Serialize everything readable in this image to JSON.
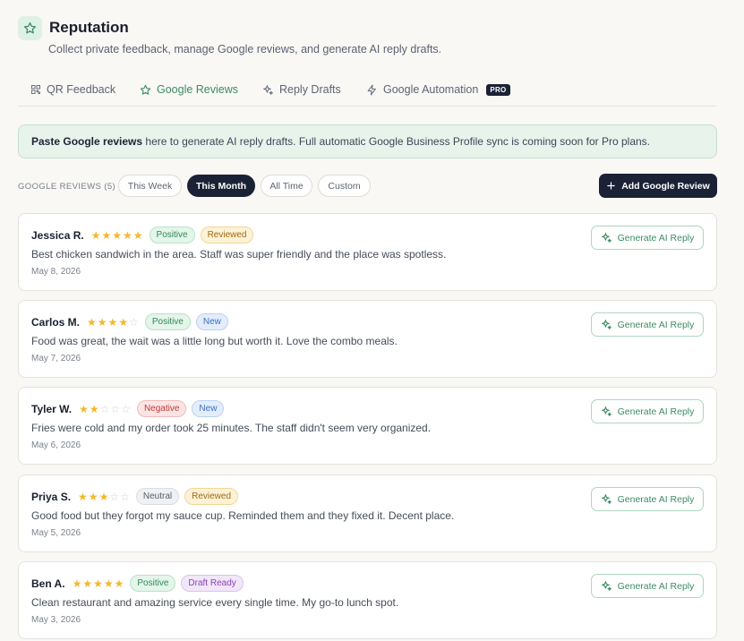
{
  "header": {
    "title": "Reputation",
    "subtitle": "Collect private feedback, manage Google reviews, and generate AI reply drafts."
  },
  "tabs": [
    {
      "label": "QR Feedback",
      "icon": "qr-grid-icon"
    },
    {
      "label": "Google Reviews",
      "icon": "star-icon",
      "active": true
    },
    {
      "label": "Reply Drafts",
      "icon": "sparkle-icon"
    },
    {
      "label": "Google Automation",
      "icon": "bolt-icon",
      "badge": "PRO"
    }
  ],
  "banner": {
    "bold": "Paste Google reviews",
    "text": " here to generate AI reply drafts. Full automatic Google Business Profile sync is coming soon for Pro plans."
  },
  "filters": {
    "count_label": "GOOGLE REVIEWS (5)",
    "pills": [
      "This Week",
      "This Month",
      "All Time",
      "Custom"
    ],
    "active": "This Month",
    "add_button": "Add Google Review"
  },
  "colors": {
    "accent_green": "#3c8c62",
    "dark_navy": "#1c2236",
    "star_gold": "#f4b82b"
  },
  "generate_label": "Generate AI Reply",
  "reviews": [
    {
      "name": "Jessica R.",
      "rating": 5,
      "sentiment": "Positive",
      "status": "Reviewed",
      "text": "Best chicken sandwich in the area. Staff was super friendly and the place was spotless.",
      "date": "May 8, 2026"
    },
    {
      "name": "Carlos M.",
      "rating": 4,
      "sentiment": "Positive",
      "status": "New",
      "text": "Food was great, the wait was a little long but worth it. Love the combo meals.",
      "date": "May 7, 2026"
    },
    {
      "name": "Tyler W.",
      "rating": 2,
      "sentiment": "Negative",
      "status": "New",
      "text": "Fries were cold and my order took 25 minutes. The staff didn't seem very organized.",
      "date": "May 6, 2026"
    },
    {
      "name": "Priya S.",
      "rating": 3,
      "sentiment": "Neutral",
      "status": "Reviewed",
      "text": "Good food but they forgot my sauce cup. Reminded them and they fixed it. Decent place.",
      "date": "May 5, 2026"
    },
    {
      "name": "Ben A.",
      "rating": 5,
      "sentiment": "Positive",
      "status": "Draft Ready",
      "text": "Clean restaurant and amazing service every single time. My go-to lunch spot.",
      "date": "May 3, 2026"
    }
  ]
}
